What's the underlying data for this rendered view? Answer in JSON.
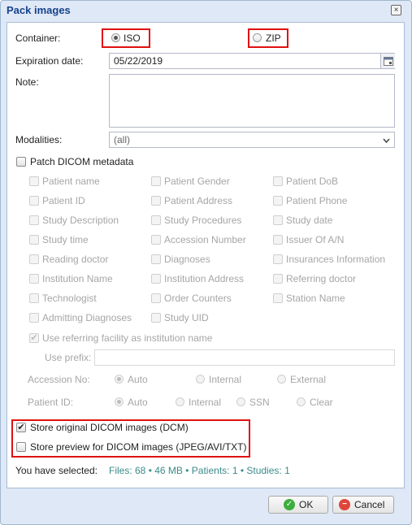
{
  "dialog": {
    "title": "Pack images",
    "close_glyph": "×"
  },
  "container": {
    "label": "Container:",
    "options": [
      "ISO",
      "ZIP"
    ],
    "selected": "ISO"
  },
  "expiration": {
    "label": "Expiration date:",
    "value": "05/22/2019"
  },
  "note": {
    "label": "Note:",
    "value": ""
  },
  "modalities": {
    "label": "Modalities:",
    "value": "(all)"
  },
  "patch": {
    "label": "Patch DICOM metadata",
    "checked": false,
    "fields": [
      "Patient name",
      "Patient Gender",
      "Patient DoB",
      "Patient ID",
      "Patient Address",
      "Patient Phone",
      "Study Description",
      "Study Procedures",
      "Study date",
      "Study time",
      "Accession Number",
      "Issuer Of A/N",
      "Reading doctor",
      "Diagnoses",
      "Insurances Information",
      "Institution Name",
      "Institution Address",
      "Referring doctor",
      "Technologist",
      "Order Counters",
      "Station Name",
      "Admitting Diagnoses",
      "Study UID"
    ],
    "use_referring": {
      "label": "Use referring facility as institution name",
      "checked": true
    },
    "use_prefix": {
      "label": "Use prefix:",
      "value": ""
    },
    "accession": {
      "label": "Accession No:",
      "options": [
        "Auto",
        "Internal",
        "External"
      ],
      "selected": "Auto"
    },
    "patient_id": {
      "label": "Patient ID:",
      "options": [
        "Auto",
        "Internal",
        "SSN",
        "Clear"
      ],
      "selected": "Auto"
    }
  },
  "store_original": {
    "label": "Store original DICOM images (DCM)",
    "checked": true
  },
  "store_preview": {
    "label": "Store preview for DICOM images (JPEG/AVI/TXT)",
    "checked": false
  },
  "selection": {
    "label": "You have selected:",
    "files": "Files: 68",
    "size": "46 MB",
    "patients": "Patients: 1",
    "studies": "Studies: 1"
  },
  "buttons": {
    "ok": "OK",
    "cancel": "Cancel"
  },
  "colors": {
    "highlight": "#e01010",
    "title": "#15428b",
    "ok_icon": "#3cae3c",
    "cancel_icon": "#e0453a"
  },
  "icons": {
    "calendar": "calendar-icon",
    "dropdown": "chevron-down-icon",
    "ok": "check-circle-icon",
    "cancel": "cancel-circle-icon"
  }
}
